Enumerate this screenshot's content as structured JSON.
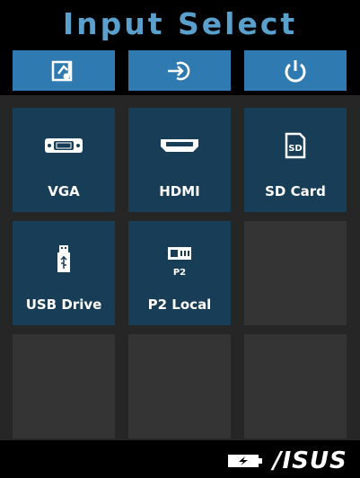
{
  "header": {
    "title": "Input Select"
  },
  "tabs": [
    {
      "icon": "media-icon"
    },
    {
      "icon": "input-source-icon"
    },
    {
      "icon": "power-icon"
    }
  ],
  "sources": [
    {
      "label": "VGA",
      "icon": "vga-port-icon"
    },
    {
      "label": "HDMI",
      "icon": "hdmi-port-icon"
    },
    {
      "label": "SD Card",
      "icon": "sd-card-icon"
    },
    {
      "label": "USB Drive",
      "icon": "usb-drive-icon"
    },
    {
      "label": "P2 Local",
      "icon": "p2-local-icon",
      "icon_text": "P2"
    }
  ],
  "footer": {
    "brand": "/ISUS",
    "battery_icon": "battery-charging-icon"
  },
  "colors": {
    "accent": "#2f7ab0",
    "title": "#5aa0cc",
    "tile_active": "#183d56",
    "tile_empty": "#343434"
  }
}
